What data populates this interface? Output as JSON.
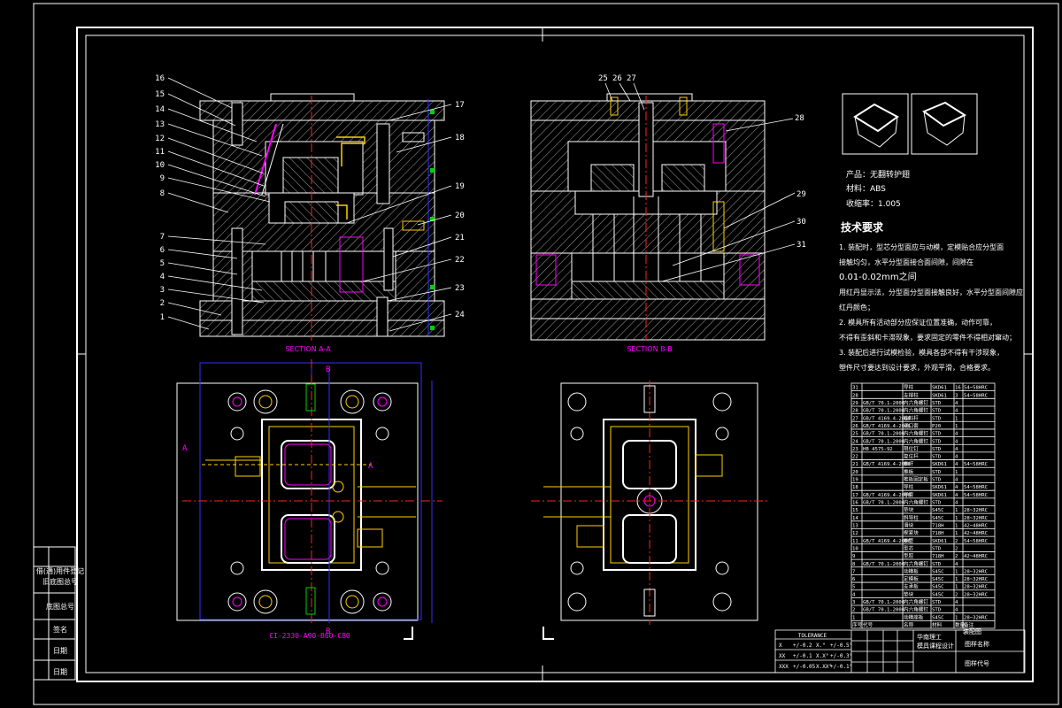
{
  "colors": {
    "background": "#000000",
    "frame": "#ffffff",
    "part": "#ffffff",
    "hatch": "#c8c8c8",
    "leader": "#ffffff",
    "balloon_text": "#ffffff",
    "section_label": "#ff00ff",
    "center_line": "#ff2020",
    "dimension": "#3030ff",
    "cooling": "#ffd000",
    "screw": "#ff00ff",
    "green_marker": "#00d000",
    "table_text": "#ffffff"
  },
  "views": {
    "section_aa_label": "SECTION A-A",
    "section_bb_label": "SECTION B-B",
    "plan_note": "CI-2330-A90-B60-C80",
    "section_marks": {
      "a": "A",
      "b": "B"
    }
  },
  "balloons_left": [
    "16",
    "15",
    "14",
    "13",
    "12",
    "11",
    "10",
    "9",
    "8",
    "7",
    "6",
    "5",
    "4",
    "3",
    "2",
    "1"
  ],
  "balloons_right_left_view": [
    "17",
    "18",
    "19",
    "20",
    "21",
    "22",
    "23",
    "24"
  ],
  "balloons_top_right_view": [
    "25",
    "26",
    "27"
  ],
  "balloons_right_right_view": [
    "28",
    "29",
    "30",
    "31"
  ],
  "product": {
    "name_line": "产品：无翻转护翅",
    "material_line": "材料：ABS",
    "shrink_line": "收缩率：1.005"
  },
  "tech": {
    "title": "技术要求",
    "lines": [
      "1. 装配时，型芯分型面应与动模，定模贴合应分型面",
      "接触均匀，水平分型面接合面间隙，间隙在",
      "0.01-0.02mm之间",
      "用红丹显示法，分型面分型面接触良好，水平分型面间隙应",
      "红丹颜色；",
      "2. 模具所有活动部分应保证位置准确，动作可靠，",
      "不得有歪斜和卡滞现象，要求固定的零件不得相对窜动；",
      "3. 装配后进行试模检验，模具各部不得有干涉现象，",
      "塑件尺寸要达到设计要求，外观平滑，合格要求。"
    ]
  },
  "bom": {
    "rows": [
      [
        "31",
        "",
        "导柱",
        "SKD61",
        "16",
        "54~58HRC"
      ],
      [
        "28",
        "",
        "支撑柱",
        "SKD61",
        "3",
        "54~58HRC"
      ],
      [
        "29",
        "GB/T 70.1-2000",
        "内六角螺钉",
        "STD",
        "4",
        ""
      ],
      [
        "28",
        "GB/T 70.1-2000",
        "内六角螺钉",
        "STD",
        "4",
        ""
      ],
      [
        "27",
        "GB/T 4169.4-2006",
        "拉料杆",
        "STD",
        "1",
        ""
      ],
      [
        "26",
        "GB/T 4169.4-2006",
        "浇口套",
        "P20",
        "1",
        ""
      ],
      [
        "25",
        "GB/T 70.1-2000",
        "内六角螺钉",
        "STD",
        "4",
        ""
      ],
      [
        "24",
        "GB/T 70.1-2000",
        "内六角螺钉",
        "STD",
        "4",
        ""
      ],
      [
        "23",
        "HB 4575-92",
        "限位钉",
        "STD",
        "4",
        ""
      ],
      [
        "22",
        "",
        "复位杆",
        "STD",
        "4",
        ""
      ],
      [
        "21",
        "GB/T 4169.4-2006",
        "推杆",
        "SKD61",
        "4",
        "54~58HRC"
      ],
      [
        "20",
        "",
        "推板",
        "STD",
        "1",
        ""
      ],
      [
        "19",
        "",
        "推板固定板",
        "STD",
        "4",
        ""
      ],
      [
        "18",
        "",
        "导柱",
        "SKD61",
        "4",
        "54~58HRC"
      ],
      [
        "17",
        "GB/T 4169.4-2006",
        "导套",
        "SKD61",
        "4",
        "54~58HRC"
      ],
      [
        "16",
        "GB/T 70.1-2000",
        "内六角螺钉",
        "STD",
        "4",
        ""
      ],
      [
        "15",
        "",
        "垫块",
        "S45C",
        "1",
        "28~32HRC"
      ],
      [
        "14",
        "",
        "斜导柱",
        "S45C",
        "1",
        "28~32HRC"
      ],
      [
        "13",
        "",
        "滑块",
        "718H",
        "1",
        "42~48HRC"
      ],
      [
        "12",
        "",
        "楔紧块",
        "718H",
        "1",
        "42~48HRC"
      ],
      [
        "11",
        "GB/T 4169.4-2006",
        "推管",
        "SKD61",
        "2",
        "54~58HRC"
      ],
      [
        "10",
        "",
        "型芯",
        "STD",
        "2",
        ""
      ],
      [
        "9",
        "",
        "型腔",
        "718H",
        "2",
        "42~48HRC"
      ],
      [
        "8",
        "GB/T 70.1-2000",
        "内六角螺钉",
        "STD",
        "4",
        ""
      ],
      [
        "7",
        "",
        "动模板",
        "S45C",
        "1",
        "28~32HRC"
      ],
      [
        "6",
        "",
        "定模板",
        "S45C",
        "1",
        "28~32HRC"
      ],
      [
        "5",
        "",
        "支承板",
        "S45C",
        "1",
        "28~32HRC"
      ],
      [
        "4",
        "",
        "垫块",
        "S45C",
        "2",
        "28~32HRC"
      ],
      [
        "3",
        "GB/T 70.1-2000",
        "内六角螺钉",
        "STD",
        "4",
        ""
      ],
      [
        "2",
        "GB/T 70.1-2000",
        "内六角螺钉",
        "STD",
        "4",
        ""
      ],
      [
        "1",
        "",
        "动模座板",
        "S45C",
        "1",
        "28~32HRC"
      ]
    ],
    "header": [
      "序号",
      "代号",
      "名称",
      "材料",
      "数量",
      "备注"
    ]
  },
  "title_block": {
    "tolerance_title": "TOLERANCE",
    "tolerance_rows": [
      [
        "X",
        "+/-0.2",
        "X.°",
        "+/-0.5°"
      ],
      [
        "XX",
        "+/-0.1",
        "X.X°",
        "+/-0.3°"
      ],
      [
        "XXX",
        "+/-0.05",
        "X.XX°",
        "+/-0.1°"
      ]
    ],
    "school_line1": "华南理工",
    "school_line2": "模具课程设计",
    "drawing_title": "装配图",
    "drawing_name_label": "图样名称",
    "drawing_no_label": "图样代号"
  },
  "left_strip": {
    "cells": [
      "借(通)用件登记",
      "旧底图总号",
      "底图总号",
      "签名",
      "日期",
      "日期"
    ]
  }
}
